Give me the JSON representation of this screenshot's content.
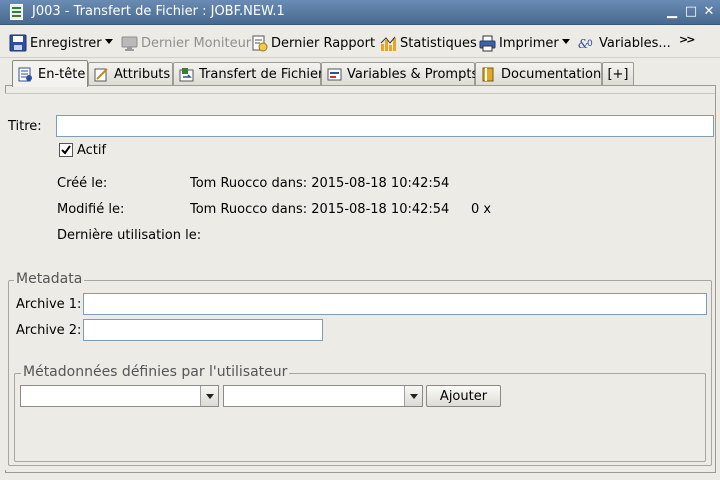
{
  "window": {
    "title": "J003 - Transfert de Fichier : JOBF.NEW.1",
    "minimize_glyph": "▁",
    "maximize_glyph": "□",
    "close_glyph": "✕"
  },
  "toolbar": {
    "save_label": "Enregistrer",
    "last_monitor_label": "Dernier Moniteur",
    "last_report_label": "Dernier Rapport",
    "statistics_label": "Statistiques",
    "print_label": "Imprimer",
    "variables_label": "Variables...",
    "more_glyph": ">>"
  },
  "tabs": [
    {
      "label": "En-tête",
      "icon": "header-icon",
      "active": true
    },
    {
      "label": "Attributs",
      "icon": "attributes-icon",
      "active": false
    },
    {
      "label": "Transfert de Fichier",
      "icon": "file-transfer-icon",
      "active": false
    },
    {
      "label": "Variables & Prompts",
      "icon": "variables-prompts-icon",
      "active": false
    },
    {
      "label": "Documentation",
      "icon": "documentation-icon",
      "active": false
    },
    {
      "label": "[+]",
      "icon": "add-tab-icon",
      "active": false
    }
  ],
  "header": {
    "title_label": "Titre:",
    "title_value": "",
    "active_label": "Actif",
    "active_checked": true,
    "created_label": "Créé le:",
    "created_value": "Tom Ruocco dans: 2015-08-18 10:42:54",
    "modified_label": "Modifié le:",
    "modified_value": "Tom Ruocco dans: 2015-08-18 10:42:54",
    "modified_count": "0 x",
    "last_used_label": "Dernière utilisation le:",
    "last_used_value": ""
  },
  "metadata": {
    "group_title": "Metadata",
    "archive1_label": "Archive 1:",
    "archive1_value": "",
    "archive2_label": "Archive 2:",
    "archive2_value": "",
    "user_group_title": "Métadonnées définies par l'utilisateur",
    "combo1_value": "",
    "combo2_value": "",
    "add_label": "Ajouter"
  },
  "colors": {
    "titlebar_top": "#6a8cb4",
    "titlebar_bottom": "#48698f",
    "background": "#ecebe6",
    "field_border": "#7f9db9"
  }
}
